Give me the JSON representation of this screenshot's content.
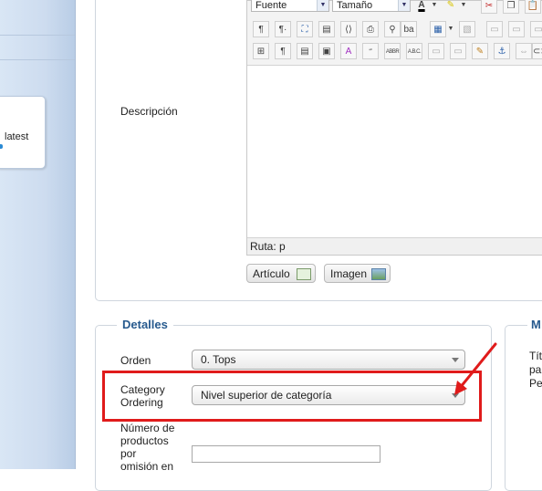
{
  "sidebar": {
    "card_text": "latest"
  },
  "description": {
    "label": "Descripción",
    "toolbar": {
      "font_select": "Fuente",
      "size_select": "Tamaño",
      "row1": [
        "¶",
        "¶·",
        "",
        "",
        "",
        "",
        "",
        "ba",
        "",
        "",
        "",
        "",
        "",
        "",
        "",
        "",
        ""
      ],
      "row2": [
        "",
        "¶",
        "",
        "",
        "A",
        "“”",
        "ABBR",
        "A.B.C.",
        "",
        "",
        "",
        "",
        "",
        "",
        "",
        "",
        ""
      ]
    },
    "path": "Ruta: p",
    "article_button": "Artículo",
    "image_button": "Imagen"
  },
  "detalles": {
    "legend": "Detalles",
    "orden_label": "Orden",
    "orden_value": "0. Tops",
    "category_label_line1": "Category",
    "category_label_line2": "Ordering",
    "category_value": "Nivel superior de categoría",
    "num_label_line1": "Número de",
    "num_label_line2": "productos",
    "num_label_line3": "por",
    "num_label_line4": "omisión en",
    "num_value": ""
  },
  "right_panel": {
    "legend": "M",
    "line1": "Títl",
    "line2": "pa",
    "line3": "Pe"
  },
  "colors": {
    "annotation": "#e01b1b",
    "legend": "#275a8e",
    "sidebar": "#cddcef"
  }
}
